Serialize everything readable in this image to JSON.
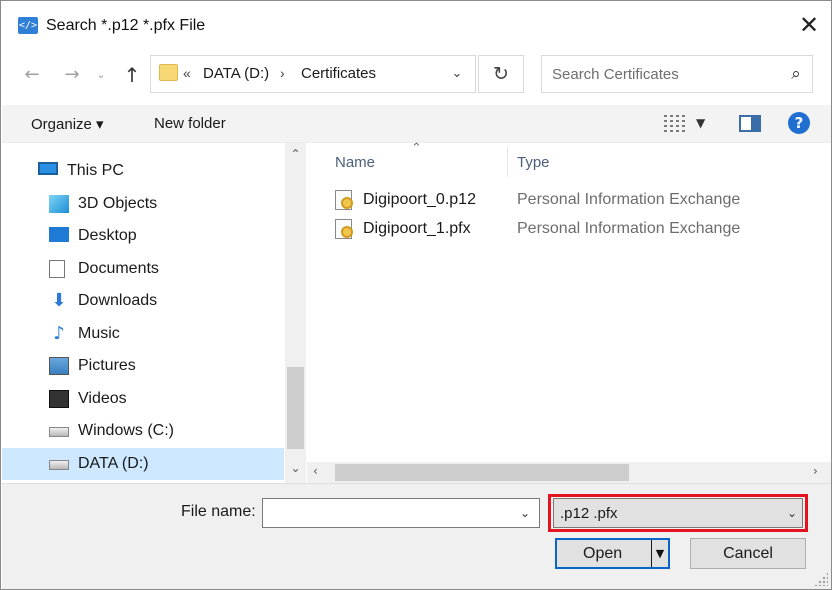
{
  "window": {
    "title": "Search *.p12 *.pfx File",
    "close_glyph": "✕"
  },
  "address_bar": {
    "breadcrumb_overflow": "«",
    "crumbs": [
      "DATA (D:)",
      "Certificates"
    ],
    "separator": "›"
  },
  "search": {
    "placeholder": "Search Certificates"
  },
  "toolbar": {
    "organize_label": "Organize ▾",
    "new_folder_label": "New folder",
    "help_glyph": "?"
  },
  "nav_pane": {
    "items": [
      {
        "label": "This PC",
        "icon": "this-pc-icon"
      },
      {
        "label": "3D Objects",
        "icon": "3d-objects-icon"
      },
      {
        "label": "Desktop",
        "icon": "desktop-icon"
      },
      {
        "label": "Documents",
        "icon": "documents-icon"
      },
      {
        "label": "Downloads",
        "icon": "downloads-icon"
      },
      {
        "label": "Music",
        "icon": "music-icon"
      },
      {
        "label": "Pictures",
        "icon": "pictures-icon"
      },
      {
        "label": "Videos",
        "icon": "videos-icon"
      },
      {
        "label": "Windows (C:)",
        "icon": "drive-c-icon"
      },
      {
        "label": "DATA (D:)",
        "icon": "drive-d-icon",
        "selected": true
      }
    ]
  },
  "file_list": {
    "columns": [
      "Name",
      "Type"
    ],
    "rows": [
      {
        "name": "Digipoort_0.p12",
        "type": "Personal Information Exchange"
      },
      {
        "name": "Digipoort_1.pfx",
        "type": "Personal Information Exchange"
      }
    ]
  },
  "bottom": {
    "file_name_label": "File name:",
    "file_name_value": "",
    "filter_value": ".p12 .pfx",
    "open_label": "Open",
    "cancel_label": "Cancel"
  },
  "colors": {
    "selection": "#cde8ff",
    "accent": "#0a64c8",
    "highlight_border": "#e3141f",
    "help": "#1f6fd0"
  }
}
